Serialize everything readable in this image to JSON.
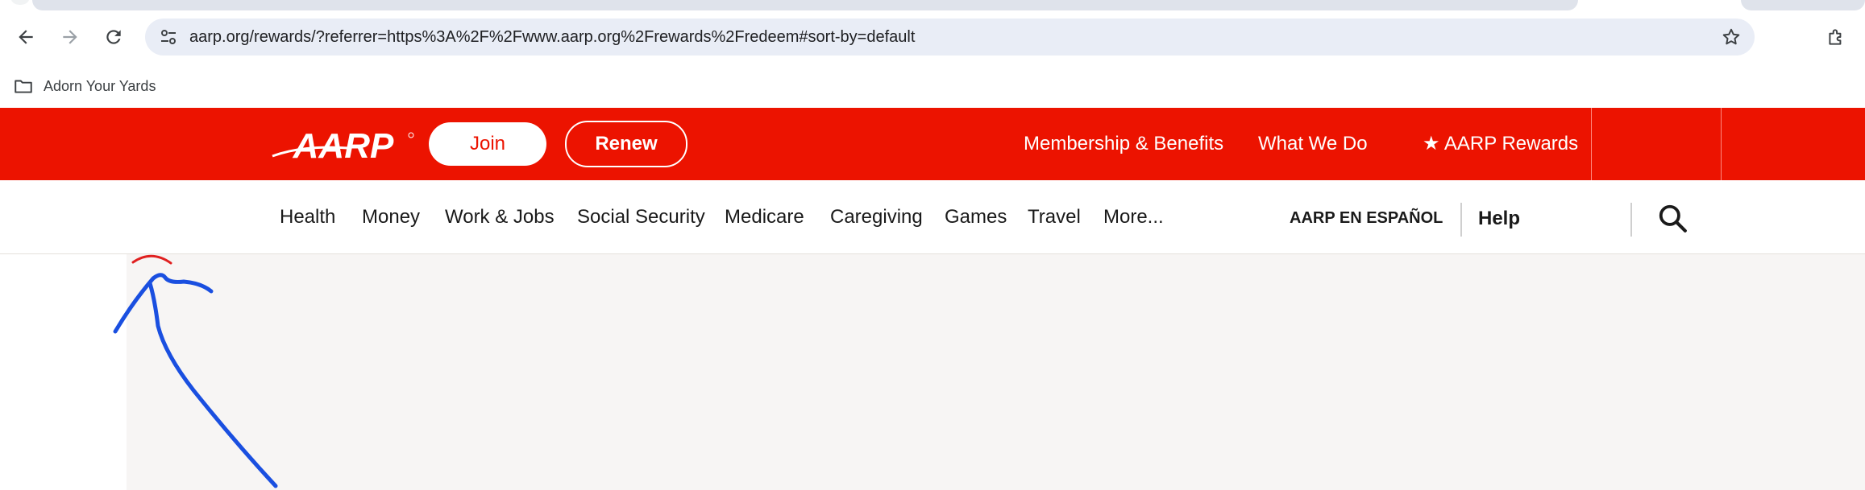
{
  "browser": {
    "url": "aarp.org/rewards/?referrer=https%3A%2F%2Fwww.aarp.org%2Frewards%2Fredeem#sort-by=default",
    "bookmarks": [
      {
        "label": "Adorn Your Yards",
        "icon": "folder-icon"
      }
    ]
  },
  "header": {
    "logo_text": "AARP",
    "join_label": "Join",
    "renew_label": "Renew",
    "links": [
      {
        "label": "Membership & Benefits"
      },
      {
        "label": "What We Do"
      },
      {
        "label": "★ AARP Rewards"
      }
    ],
    "brand_color": "#ec1300"
  },
  "subnav": {
    "items": [
      {
        "label": "Health"
      },
      {
        "label": "Money"
      },
      {
        "label": "Work & Jobs"
      },
      {
        "label": "Social Security"
      },
      {
        "label": "Medicare"
      },
      {
        "label": "Caregiving"
      },
      {
        "label": "Games"
      },
      {
        "label": "Travel"
      },
      {
        "label": "More..."
      }
    ],
    "espanol_label": "AARP EN ESPAÑOL",
    "help_label": "Help",
    "search_icon": "search-icon"
  },
  "annotation": {
    "arrow_color": "#1a4fe0",
    "mark_color": "#e02020"
  }
}
